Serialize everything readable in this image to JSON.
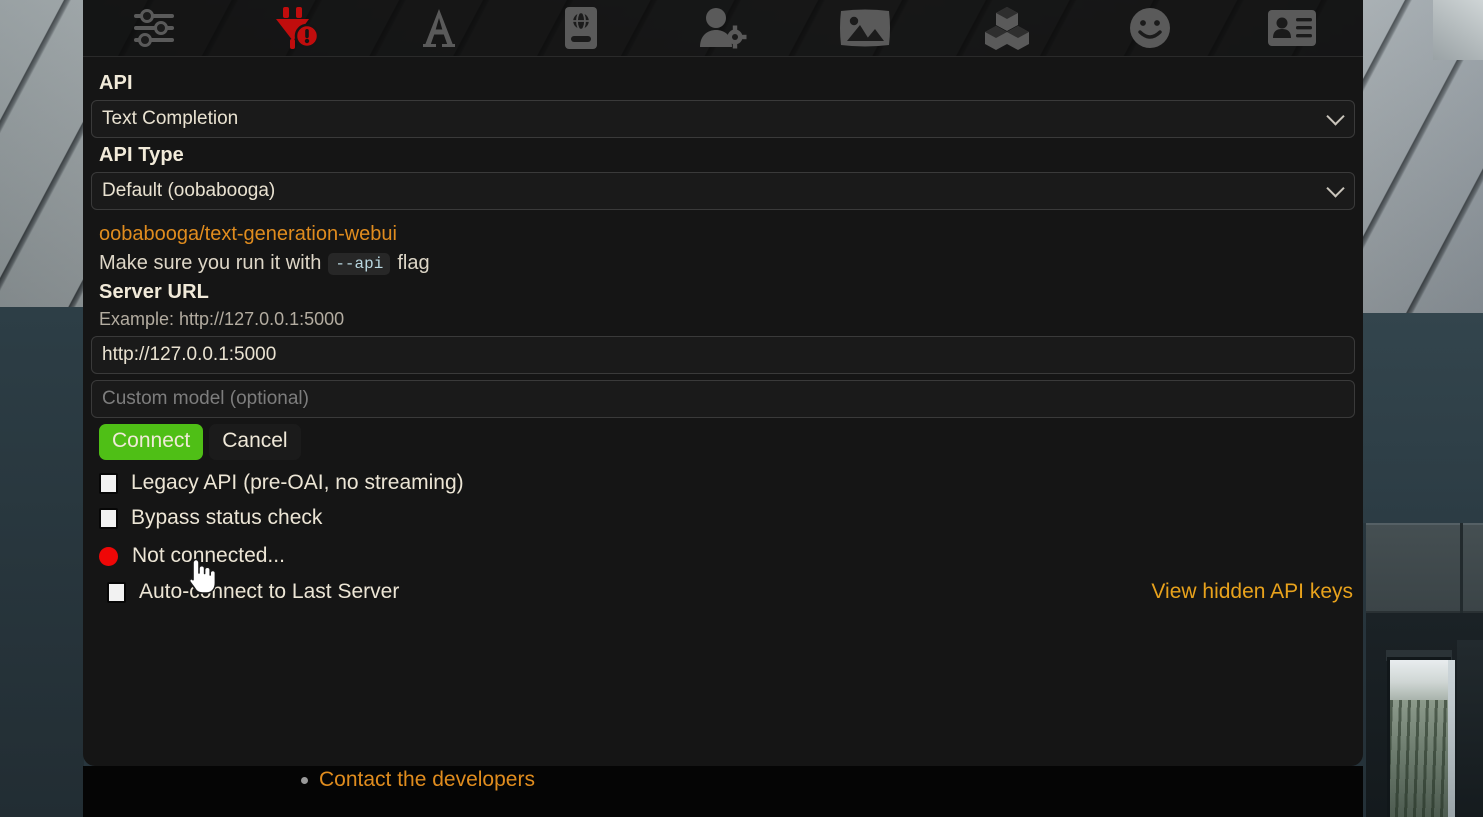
{
  "toolbar": {
    "items": [
      {
        "icon": "sliders-icon",
        "name": "toolbar-ai-response-configuration",
        "state": "normal"
      },
      {
        "icon": "plug-warning-icon",
        "name": "toolbar-api-connections",
        "state": "alert"
      },
      {
        "icon": "letter-a-icon",
        "name": "toolbar-advanced-formatting",
        "state": "normal"
      },
      {
        "icon": "world-info-icon",
        "name": "toolbar-worldinfo",
        "state": "normal"
      },
      {
        "icon": "user-settings-icon",
        "name": "toolbar-user-settings",
        "state": "normal"
      },
      {
        "icon": "image-icon",
        "name": "toolbar-backgrounds",
        "state": "normal"
      },
      {
        "icon": "cubes-icon",
        "name": "toolbar-extensions",
        "state": "normal"
      },
      {
        "icon": "smiley-icon",
        "name": "toolbar-persona-management",
        "state": "normal"
      },
      {
        "icon": "id-card-icon",
        "name": "toolbar-character-management",
        "state": "normal"
      }
    ]
  },
  "panel": {
    "api": {
      "label": "API",
      "selected": "Text Completion"
    },
    "api_type": {
      "label": "API Type",
      "selected": "Default (oobabooga)"
    },
    "repo_link": "oobabooga/text-generation-webui",
    "flag_hint": {
      "before": "Make sure you run it with",
      "code": "--api",
      "after": "flag"
    },
    "server_url": {
      "label": "Server URL",
      "example": "Example: http://127.0.0.1:5000",
      "value": "http://127.0.0.1:5000"
    },
    "custom_model": {
      "placeholder": "Custom model (optional)",
      "value": ""
    },
    "buttons": {
      "connect": "Connect",
      "cancel": "Cancel"
    },
    "checkboxes": [
      {
        "label": "Legacy API (pre-OAI, no streaming)",
        "checked": false,
        "name": "legacy-api-checkbox"
      },
      {
        "label": "Bypass status check",
        "checked": false,
        "name": "bypass-status-check-checkbox"
      }
    ],
    "status": {
      "text": "Not connected...",
      "color": "#ef0707"
    },
    "autoconnect": {
      "label": "Auto-connect to Last Server",
      "checked": false
    },
    "hidden_keys_link": "View hidden API keys"
  },
  "lower": {
    "dev_link": "Contact the developers"
  },
  "colors": {
    "accent_orange": "#e08c1e",
    "connect_green": "#4fbf16",
    "status_red": "#ef0707",
    "panel_bg": "#151515",
    "field_bg": "#1a1a1a"
  }
}
